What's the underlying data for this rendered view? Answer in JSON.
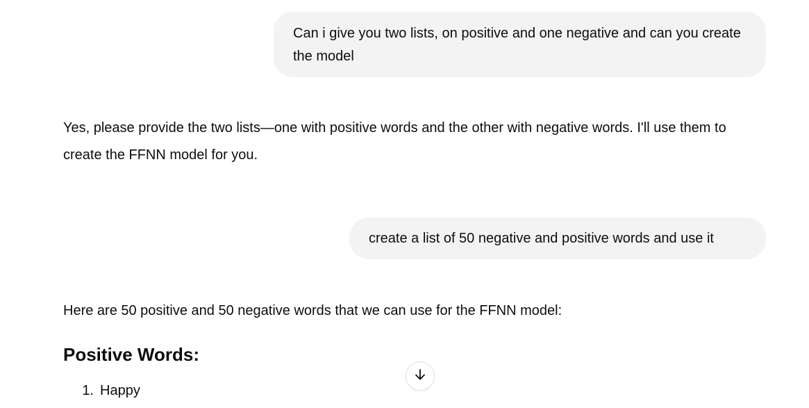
{
  "conversation": {
    "messages": [
      {
        "role": "user",
        "text": "Can i give you two lists, on positive and one negative and can you create the model"
      },
      {
        "role": "assistant",
        "text": "Yes, please provide the two lists—one with positive words and the other with negative words. I'll use them to create the FFNN model for you."
      },
      {
        "role": "user",
        "text": "create a list of 50 negative and positive words and use it"
      },
      {
        "role": "assistant",
        "intro": "Here are 50 positive and 50 negative words that we can use for the FFNN model:",
        "heading": "Positive Words:",
        "list": [
          {
            "number": "1.",
            "text": "Happy"
          }
        ]
      }
    ]
  },
  "controls": {
    "scroll_down_icon": "arrow-down-icon"
  }
}
